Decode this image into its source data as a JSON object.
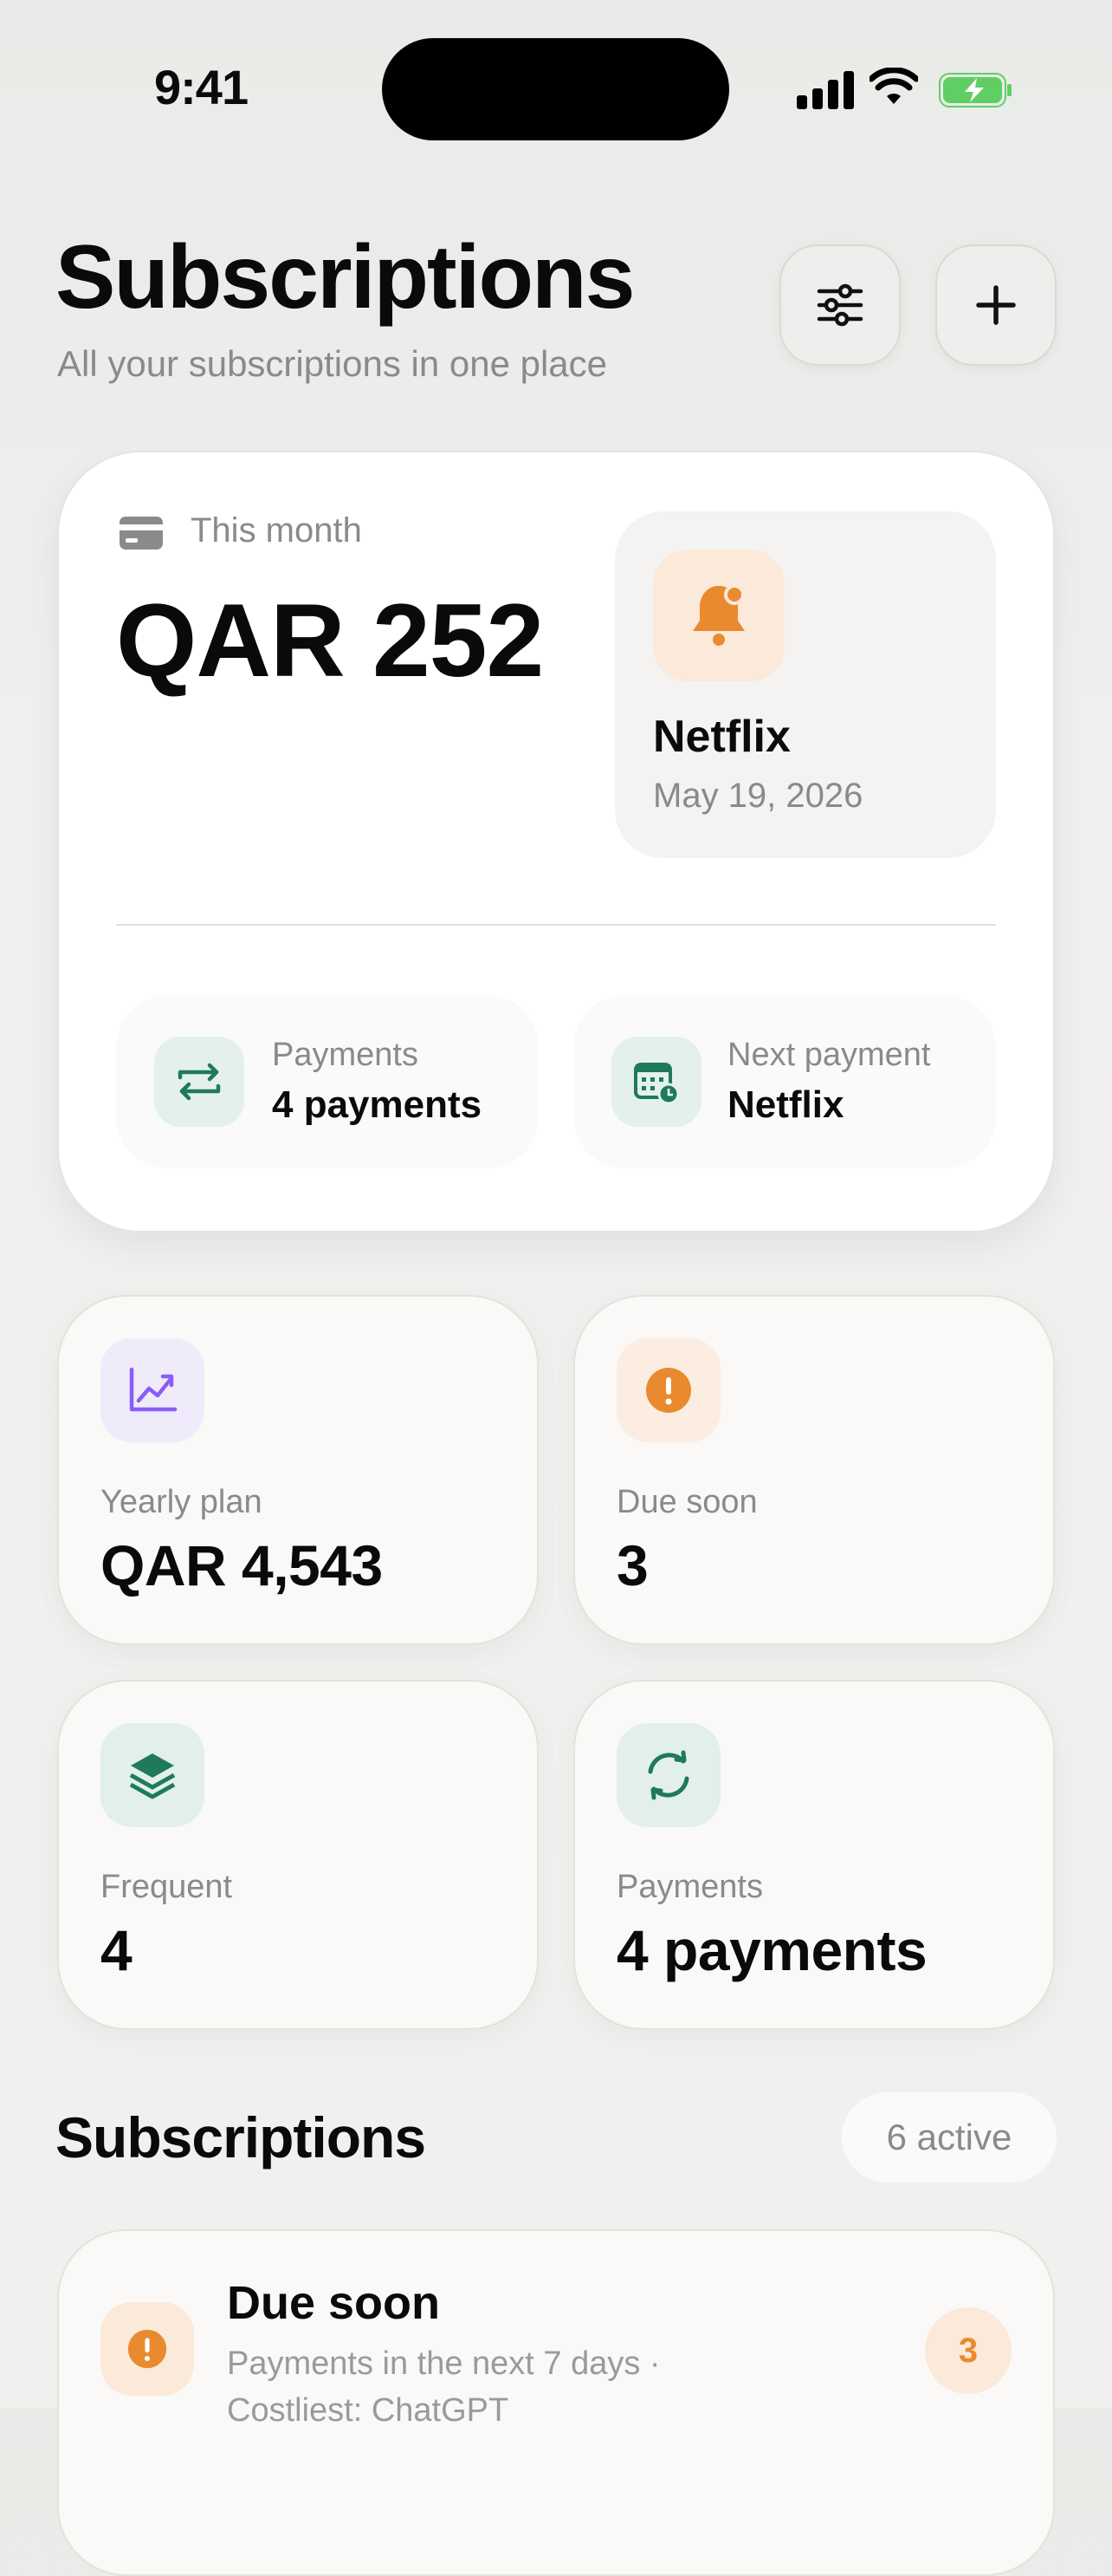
{
  "status_bar": {
    "time": "9:41"
  },
  "header": {
    "title": "Subscriptions",
    "subtitle": "All your subscriptions in one place",
    "filter_icon": "sliders-icon",
    "add_icon": "plus-icon"
  },
  "summary": {
    "period_label": "This month",
    "amount": "QAR 252",
    "next": {
      "name": "Netflix",
      "date": "May 19, 2026"
    },
    "chips": [
      {
        "label": "Payments",
        "value": "4 payments",
        "icon": "repeat-icon"
      },
      {
        "label": "Next payment",
        "value": "Netflix",
        "icon": "calendar-icon"
      }
    ]
  },
  "stats": [
    {
      "label": "Yearly plan",
      "value": "QAR 4,543",
      "icon": "chart-up-icon",
      "color": "#8b5cf6"
    },
    {
      "label": "Due soon",
      "value": "3",
      "icon": "alert-icon",
      "color": "#ea8a2e"
    },
    {
      "label": "Frequent",
      "value": "4",
      "icon": "layers-icon",
      "color": "#1f7a5a"
    },
    {
      "label": "Payments",
      "value": "4 payments",
      "icon": "refresh-icon",
      "color": "#1f7a5a"
    }
  ],
  "subscriptions": {
    "title": "Subscriptions",
    "active_count": "6 active",
    "groups": [
      {
        "title": "Due soon",
        "subtitle": "Payments in the next 7 days · Costliest: ChatGPT",
        "count": "3",
        "icon": "alert-icon"
      }
    ]
  },
  "colors": {
    "accent_orange": "#ea8a2e",
    "accent_green": "#1f7a5a",
    "accent_purple": "#8b5cf6"
  }
}
